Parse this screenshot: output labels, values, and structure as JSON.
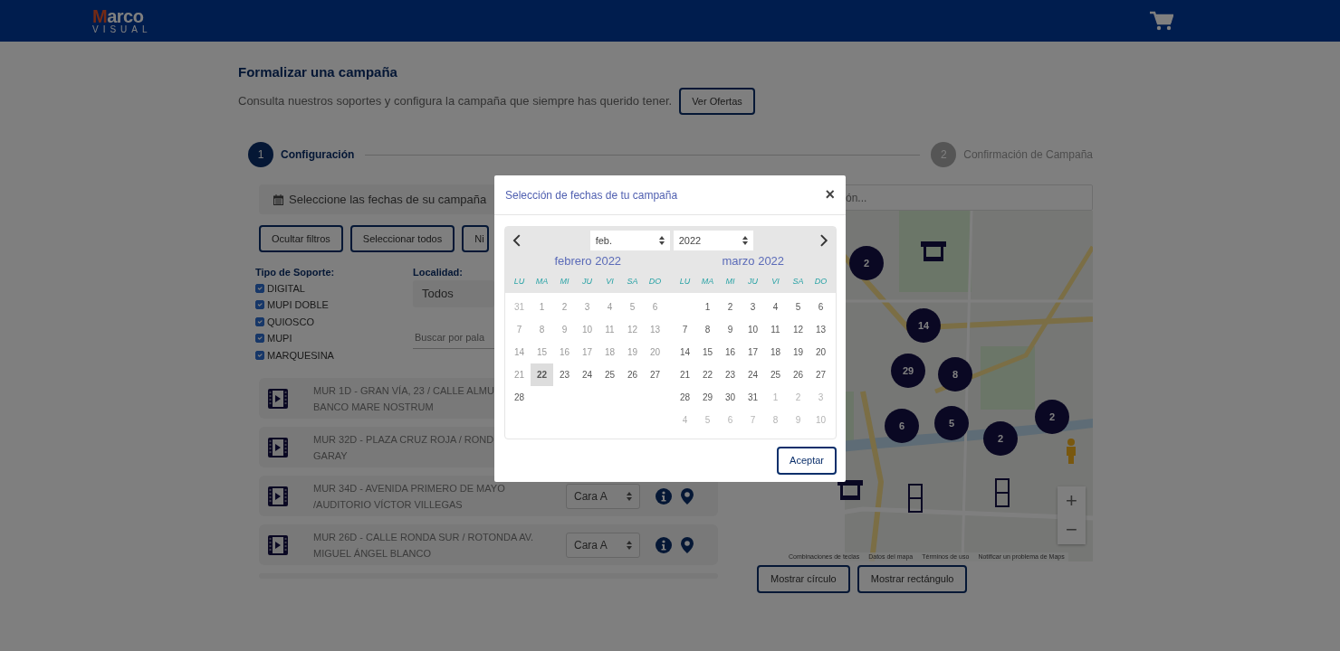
{
  "header": {
    "logo_top": "Marco",
    "logo_bottom": "VISUAL"
  },
  "page": {
    "title": "Formalizar una campaña",
    "subtitle": "Consulta nuestros soportes y configura la campaña que siempre has querido tener.",
    "offers_button": "Ver Ofertas"
  },
  "steps": [
    {
      "number": "1",
      "label": "Configuración",
      "selected": true
    },
    {
      "number": "2",
      "label": "Confirmación de Campaña",
      "selected": false
    }
  ],
  "date_bar": {
    "label": "Seleccione las fechas de su campaña"
  },
  "filter_buttons": [
    "Ocultar filtros",
    "Seleccionar todos",
    "Ni"
  ],
  "support_types": {
    "label": "Tipo de Soporte:",
    "options": [
      {
        "label": "DIGITAL",
        "checked": true
      },
      {
        "label": "MUPI DOBLE",
        "checked": true
      },
      {
        "label": "QUIOSCO",
        "checked": true
      },
      {
        "label": "MUPI",
        "checked": true
      },
      {
        "label": "MARQUESINA",
        "checked": true
      }
    ]
  },
  "locality": {
    "label": "Localidad:",
    "value": "Todos"
  },
  "keyword_search": {
    "placeholder": "Buscar por pala"
  },
  "supports": [
    {
      "lines": [
        "MUR 1D - GRAN VÍA, 23 / CALLE ALMU",
        "BANCO MARE NOSTRUM"
      ]
    },
    {
      "lines": [
        "MUR 32D - PLAZA CRUZ ROJA / ROND",
        "GARAY"
      ]
    },
    {
      "lines": [
        "MUR 34D - AVENIDA PRIMERO DE MAYO",
        "/AUDITORIO VÍCTOR VILLEGAS"
      ],
      "face": "Cara A"
    },
    {
      "lines": [
        "MUR 26D - CALLE RONDA SUR / ROTONDA AV.",
        "MIGUEL ÁNGEL BLANCO"
      ],
      "face": "Cara A"
    }
  ],
  "map": {
    "search_placeholder": "ón...",
    "markers": [
      {
        "kind": "cluster",
        "count": "2"
      },
      {
        "kind": "cluster",
        "count": "14"
      },
      {
        "kind": "cluster",
        "count": "29"
      },
      {
        "kind": "cluster",
        "count": "8"
      },
      {
        "kind": "cluster",
        "count": "6"
      },
      {
        "kind": "cluster",
        "count": "5"
      },
      {
        "kind": "cluster",
        "count": "2"
      },
      {
        "kind": "cluster",
        "count": "2"
      },
      {
        "kind": "kiosk"
      },
      {
        "kind": "kiosk"
      },
      {
        "kind": "mupi"
      },
      {
        "kind": "mupi"
      }
    ],
    "zoom_controls": [
      "+",
      "−"
    ],
    "footer_links": [
      "Combinaciones de teclas",
      "Datos del mapa",
      "Términos de uso",
      "Notificar un problema de Maps"
    ]
  },
  "map_buttons": [
    "Mostrar círculo",
    "Mostrar rectángulo"
  ],
  "modal": {
    "title": "Selección de fechas de tu campaña",
    "close": "×",
    "month_select": "feb.",
    "year_select": "2022",
    "accept": "Aceptar",
    "months": [
      {
        "title": "febrero 2022",
        "weekdays": [
          "LU",
          "MA",
          "MI",
          "JU",
          "VI",
          "SA",
          "DO"
        ],
        "weeks": [
          [
            {
              "day": "31",
              "kind": "outside"
            },
            {
              "day": "1",
              "kind": "past"
            },
            {
              "day": "2",
              "kind": "past"
            },
            {
              "day": "3",
              "kind": "past"
            },
            {
              "day": "4",
              "kind": "past"
            },
            {
              "day": "5",
              "kind": "past"
            },
            {
              "day": "6",
              "kind": "past"
            }
          ],
          [
            {
              "day": "7",
              "kind": "past"
            },
            {
              "day": "8",
              "kind": "past"
            },
            {
              "day": "9",
              "kind": "past"
            },
            {
              "day": "10",
              "kind": "past"
            },
            {
              "day": "11",
              "kind": "past"
            },
            {
              "day": "12",
              "kind": "past"
            },
            {
              "day": "13",
              "kind": "past"
            }
          ],
          [
            {
              "day": "14",
              "kind": "past"
            },
            {
              "day": "15",
              "kind": "past"
            },
            {
              "day": "16",
              "kind": "past"
            },
            {
              "day": "17",
              "kind": "past"
            },
            {
              "day": "18",
              "kind": "past"
            },
            {
              "day": "19",
              "kind": "past"
            },
            {
              "day": "20",
              "kind": "past"
            }
          ],
          [
            {
              "day": "21",
              "kind": "past"
            },
            {
              "day": "22",
              "kind": "today"
            },
            {
              "day": "23",
              "kind": "day"
            },
            {
              "day": "24",
              "kind": "day"
            },
            {
              "day": "25",
              "kind": "day"
            },
            {
              "day": "26",
              "kind": "day"
            },
            {
              "day": "27",
              "kind": "day"
            }
          ],
          [
            {
              "day": "28",
              "kind": "day"
            }
          ]
        ]
      },
      {
        "title": "marzo 2022",
        "weekdays": [
          "LU",
          "MA",
          "MI",
          "JU",
          "VI",
          "SA",
          "DO"
        ],
        "weeks": [
          [
            {
              "kind": "blank"
            },
            {
              "day": "1",
              "kind": "day"
            },
            {
              "day": "2",
              "kind": "day"
            },
            {
              "day": "3",
              "kind": "day"
            },
            {
              "day": "4",
              "kind": "day"
            },
            {
              "day": "5",
              "kind": "day"
            },
            {
              "day": "6",
              "kind": "day"
            }
          ],
          [
            {
              "day": "7",
              "kind": "day"
            },
            {
              "day": "8",
              "kind": "day"
            },
            {
              "day": "9",
              "kind": "day"
            },
            {
              "day": "10",
              "kind": "day"
            },
            {
              "day": "11",
              "kind": "day"
            },
            {
              "day": "12",
              "kind": "day"
            },
            {
              "day": "13",
              "kind": "day"
            }
          ],
          [
            {
              "day": "14",
              "kind": "day"
            },
            {
              "day": "15",
              "kind": "day"
            },
            {
              "day": "16",
              "kind": "day"
            },
            {
              "day": "17",
              "kind": "day"
            },
            {
              "day": "18",
              "kind": "day"
            },
            {
              "day": "19",
              "kind": "day"
            },
            {
              "day": "20",
              "kind": "day"
            }
          ],
          [
            {
              "day": "21",
              "kind": "day"
            },
            {
              "day": "22",
              "kind": "day"
            },
            {
              "day": "23",
              "kind": "day"
            },
            {
              "day": "24",
              "kind": "day"
            },
            {
              "day": "25",
              "kind": "day"
            },
            {
              "day": "26",
              "kind": "day"
            },
            {
              "day": "27",
              "kind": "day"
            }
          ],
          [
            {
              "day": "28",
              "kind": "day"
            },
            {
              "day": "29",
              "kind": "day"
            },
            {
              "day": "30",
              "kind": "day"
            },
            {
              "day": "31",
              "kind": "day"
            },
            {
              "day": "1",
              "kind": "outside"
            },
            {
              "day": "2",
              "kind": "outside"
            },
            {
              "day": "3",
              "kind": "outside"
            }
          ],
          [
            {
              "day": "4",
              "kind": "outside"
            },
            {
              "day": "5",
              "kind": "outside"
            },
            {
              "day": "6",
              "kind": "outside"
            },
            {
              "day": "7",
              "kind": "outside"
            },
            {
              "day": "8",
              "kind": "outside"
            },
            {
              "day": "9",
              "kind": "outside"
            },
            {
              "day": "10",
              "kind": "outside"
            }
          ]
        ]
      }
    ]
  }
}
